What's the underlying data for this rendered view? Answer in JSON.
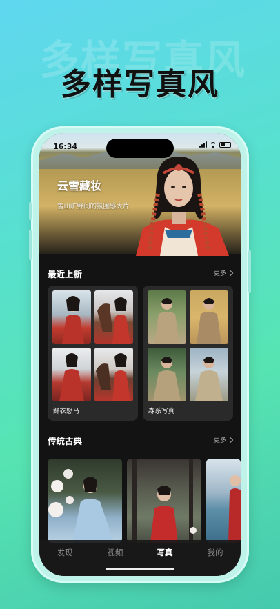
{
  "promo": {
    "watermark": "多样写真风",
    "headline": "多样写真风"
  },
  "status_bar": {
    "time": "16:34"
  },
  "hero": {
    "title": "云雪藏妆",
    "subtitle": "雪山旷野间的氛围感大片"
  },
  "sections": [
    {
      "title": "最近上新",
      "more": "更多",
      "cards": [
        {
          "label": "鲜衣怒马"
        },
        {
          "label": "森系写真"
        }
      ]
    },
    {
      "title": "传统古典",
      "more": "更多"
    }
  ],
  "tabbar": {
    "items": [
      {
        "label": "发现",
        "active": false
      },
      {
        "label": "视频",
        "active": false
      },
      {
        "label": "写真",
        "active": true
      },
      {
        "label": "我的",
        "active": false
      }
    ]
  },
  "colors": {
    "background_start": "#5fd7ef",
    "background_end": "#46c9ae",
    "screen_bg": "#131313",
    "card_bg": "#2a2a2a",
    "active_tab": "#ffffff",
    "inactive_tab": "#888888"
  }
}
